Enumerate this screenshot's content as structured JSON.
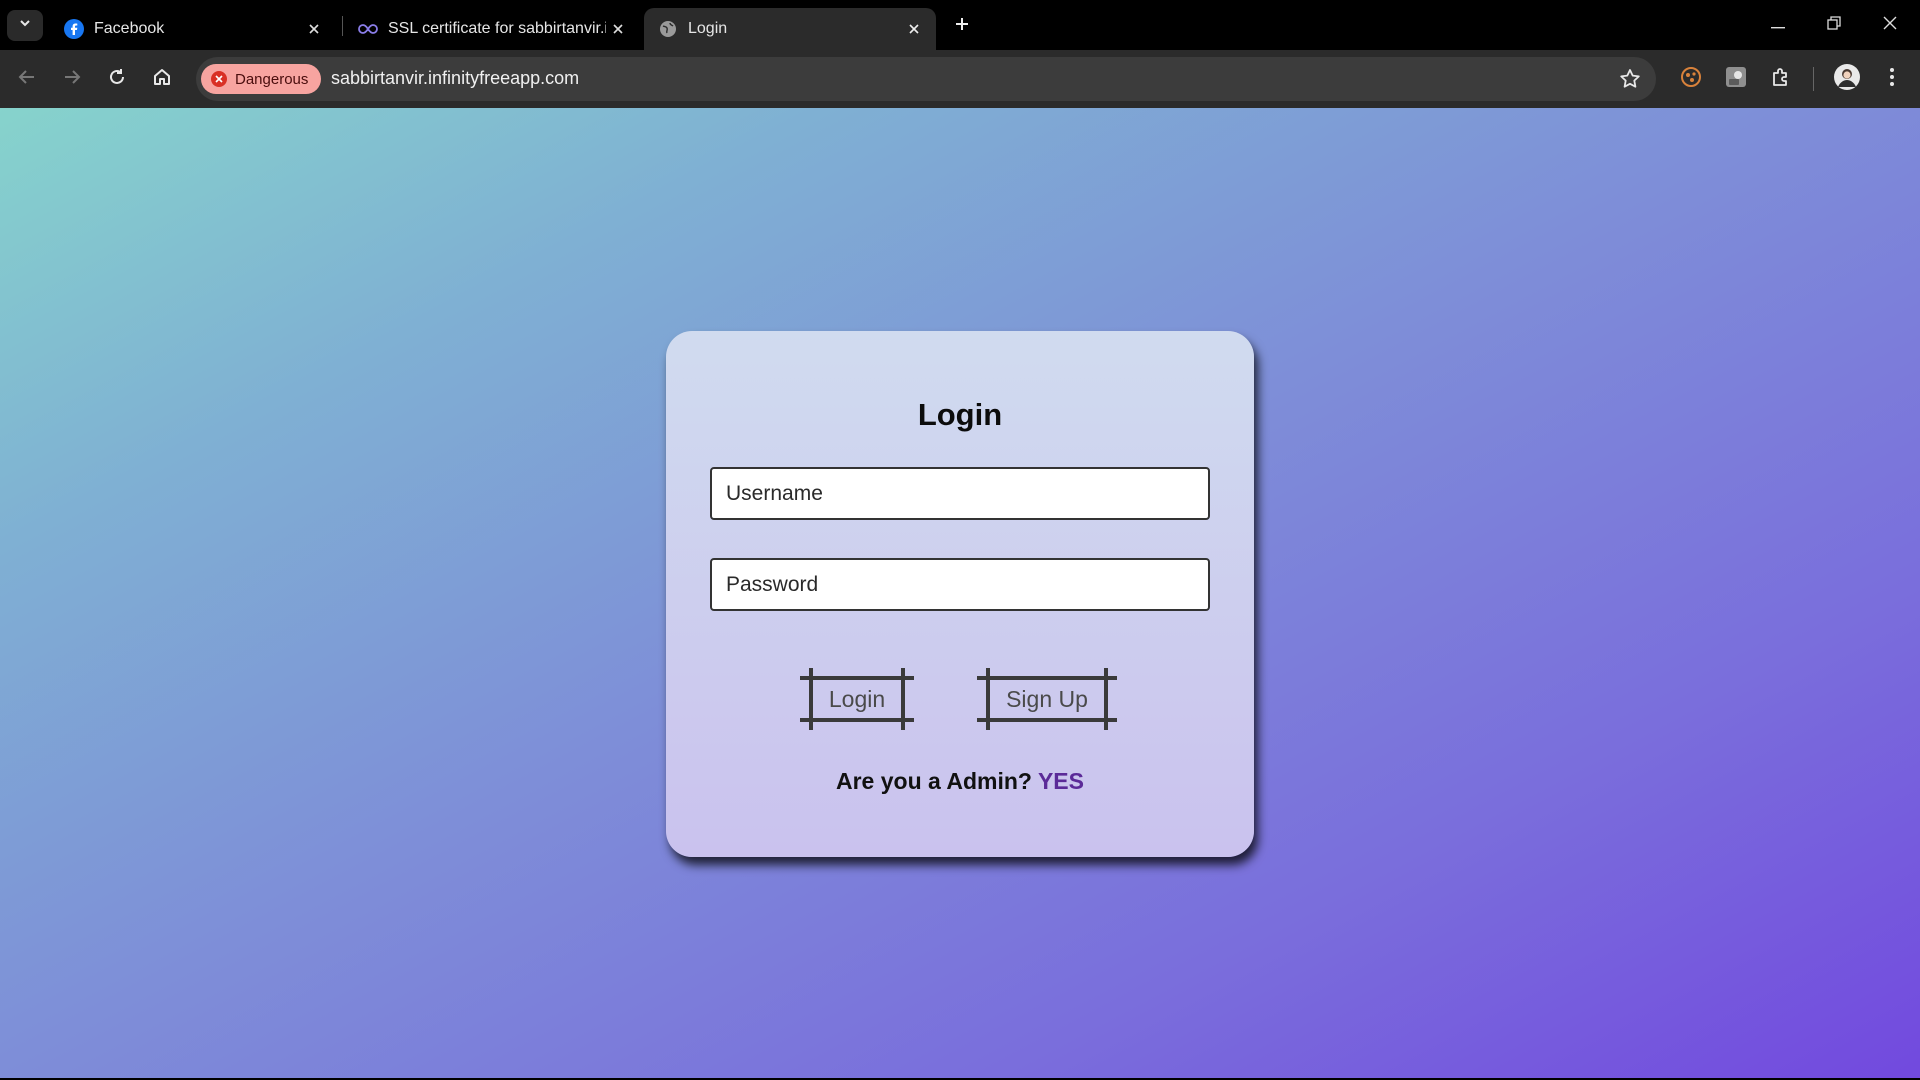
{
  "tabs": [
    {
      "title": "Facebook",
      "icon": "facebook-icon",
      "active": false
    },
    {
      "title": "SSL certificate for sabbirtanvir.in",
      "icon": "infinity-icon",
      "active": false
    },
    {
      "title": "Login",
      "icon": "globe-icon",
      "active": true
    }
  ],
  "toolbar": {
    "security_label": "Dangerous",
    "url": "sabbirtanvir.infinityfreeapp.com"
  },
  "form": {
    "title": "Login",
    "username_placeholder": "Username",
    "username_value": "",
    "password_placeholder": "Password",
    "password_value": "",
    "login_label": "Login",
    "signup_label": "Sign Up",
    "admin_question": "Are you a Admin?",
    "admin_link": "YES"
  },
  "colors": {
    "danger_chip": "#f7a4a0",
    "admin_link": "#5b2a98",
    "card": "#cfd6ef"
  }
}
